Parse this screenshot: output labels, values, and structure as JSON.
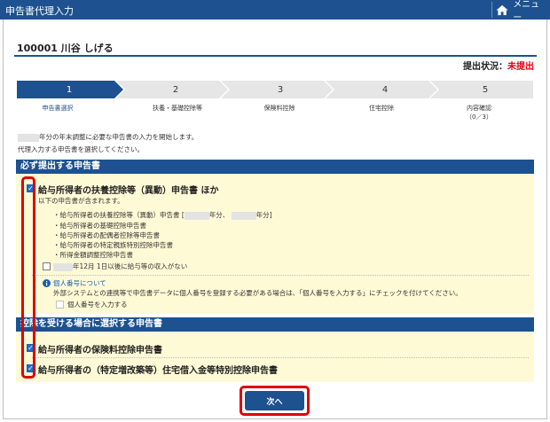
{
  "header": {
    "title": "申告書代理入力",
    "menu_label": "メニュー"
  },
  "user": {
    "name": "100001 川谷 しげる"
  },
  "status": {
    "label": "提出状況：",
    "value": "未提出"
  },
  "steps": [
    {
      "number": "1",
      "label": "申告書選択",
      "sub": ""
    },
    {
      "number": "2",
      "label": "扶養・基礎控除等",
      "sub": ""
    },
    {
      "number": "3",
      "label": "保険料控除",
      "sub": ""
    },
    {
      "number": "4",
      "label": "住宅控除",
      "sub": ""
    },
    {
      "number": "5",
      "label": "内容確認",
      "sub": "（0／3）"
    }
  ],
  "intro": {
    "line1": "年分の年末調整に必要な申告書の入力を開始します。",
    "line2": "代理入力する申告書を選択してください。"
  },
  "required_section": {
    "title": "必ず提出する申告書",
    "form_title": "給与所得者の扶養控除等（異動）申告書 ほか",
    "includes_text": "以下の申告書が含まれます。",
    "list": {
      "item1_a": "・給与所得者の扶養控除等（異動）申告書 [",
      "item1_b": "年分、",
      "item1_c": "年分]",
      "item2": "・給与所得者の基礎控除申告書",
      "item3": "・給与所得者の配偶者控除等申告書",
      "item4": "・給与所得者の特定親族特別控除申告書",
      "item5": "・所得金額調整控除申告書"
    },
    "income_option": "年12月 1日以後に給与等の収入がない",
    "mynumber_link": "個人番号について",
    "mynumber_desc": "外部システムとの連携等で申告書データに個人番号を登録する必要がある場合は、「個人番号を入力する」にチェックを付けてください。",
    "mynumber_option": "個人番号を入力する"
  },
  "optional_section": {
    "title": "控除を受ける場合に選択する申告書",
    "form1": "給与所得者の保険料控除申告書",
    "form2": "給与所得者の（特定増改築等）住宅借入金等特別控除申告書"
  },
  "next_button": "次へ",
  "colors": {
    "header": "#1d5190",
    "status": "#e60012",
    "panel": "#fffad6",
    "highlight": "#e00000"
  }
}
